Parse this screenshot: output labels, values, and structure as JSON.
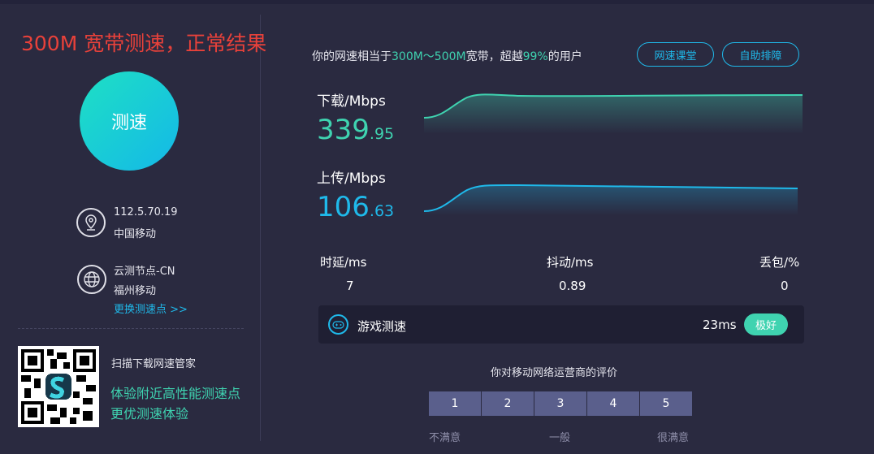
{
  "title": "300M 宽带测速，正常结果",
  "speed_button": "测速",
  "ip": {
    "address": "112.5.70.19",
    "isp": "中国移动"
  },
  "node": {
    "name": "云测节点-CN",
    "location": "福州移动",
    "change_link": "更换测速点 >>"
  },
  "promo": {
    "scan": "扫描下载网速管家",
    "line1": "体验附近高性能测速点",
    "line2": "更优测速体验"
  },
  "summary": {
    "pre": "你的网速相当于",
    "range": "300M～500M",
    "mid": "宽带，超越",
    "pct": "99%",
    "post": "的用户"
  },
  "buttons": {
    "course": "网速课堂",
    "selfhelp": "自助排障"
  },
  "download": {
    "label": "下载/Mbps",
    "int": "339",
    "dec": ".95"
  },
  "upload": {
    "label": "上传/Mbps",
    "int": "106",
    "dec": ".63"
  },
  "metrics": {
    "latency_label": "时延/ms",
    "latency": "7",
    "jitter_label": "抖动/ms",
    "jitter": "0.89",
    "loss_label": "丢包/%",
    "loss": "0"
  },
  "game": {
    "label": "游戏测速",
    "ms": "23ms",
    "badge": "极好"
  },
  "rating": {
    "question": "你对移动网络运营商的评价",
    "scores": [
      "1",
      "2",
      "3",
      "4",
      "5"
    ],
    "low": "不满意",
    "mid": "一般",
    "high": "很满意"
  },
  "colors": {
    "accent": "#3fd3b0",
    "link": "#1fb9ea",
    "title": "#e8413a"
  }
}
